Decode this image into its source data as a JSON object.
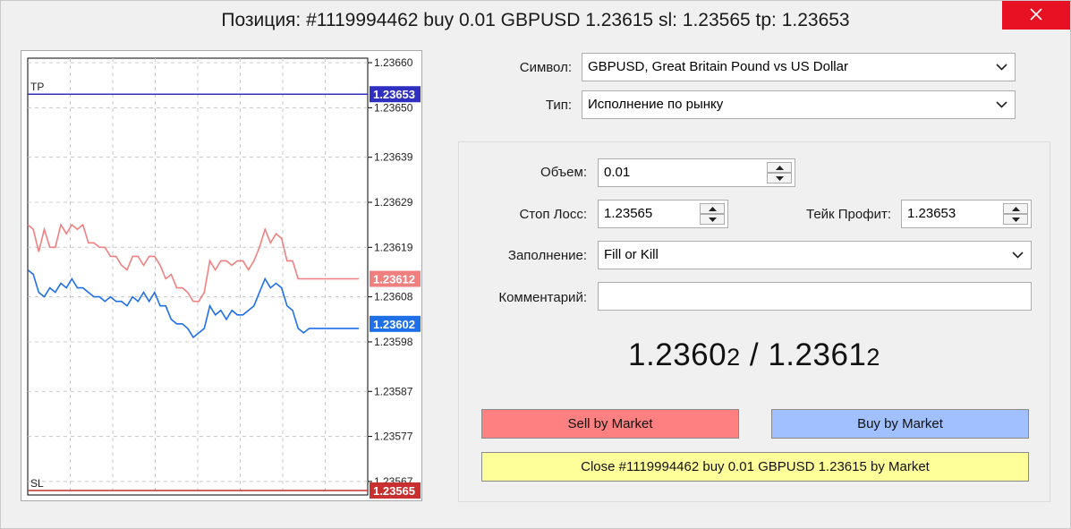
{
  "window": {
    "title": "Позиция: #1119994462 buy 0.01 GBPUSD 1.23615 sl: 1.23565 tp: 1.23653"
  },
  "form": {
    "symbol_label": "Символ:",
    "symbol_value": "GBPUSD, Great Britain Pound vs US Dollar",
    "type_label": "Тип:",
    "type_value": "Исполнение по рынку",
    "volume_label": "Объем:",
    "volume_value": "0.01",
    "sl_label": "Стоп Лосс:",
    "sl_value": "1.23565",
    "tp_label": "Тейк Профит:",
    "tp_value": "1.23653",
    "fill_label": "Заполнение:",
    "fill_value": "Fill or Kill",
    "comment_label": "Комментарий:",
    "comment_value": ""
  },
  "quote": {
    "bid_main": "1.2360",
    "bid_small": "2",
    "separator": "/",
    "ask_main": "1.2361",
    "ask_small": "2"
  },
  "buttons": {
    "sell": "Sell by Market",
    "buy": "Buy by Market",
    "close": "Close #1119994462 buy 0.01 GBPUSD 1.23615 by Market"
  },
  "colors": {
    "sell_button": "#ff8080",
    "buy_button": "#a0c0ff",
    "close_button": "#ffff99",
    "bid_line": "#1e6fe8",
    "ask_line": "#f08080",
    "tp_line": "#3030c0",
    "sl_line": "#c83030"
  },
  "chart_data": {
    "type": "line",
    "y_ticks": [
      "1.23660",
      "1.23650",
      "1.23639",
      "1.23629",
      "1.23619",
      "1.23608",
      "1.23598",
      "1.23587",
      "1.23577",
      "1.23567"
    ],
    "ylim": [
      1.23564,
      1.23661
    ],
    "levels": [
      {
        "label": "TP",
        "value": 1.23653,
        "price_label": "1.23653"
      },
      {
        "label": "SL",
        "value": 1.23565,
        "price_label": "1.23565"
      }
    ],
    "current": {
      "ask": {
        "value": 1.23612,
        "price_label": "1.23612"
      },
      "bid": {
        "value": 1.23602,
        "price_label": "1.23602"
      }
    },
    "series": [
      {
        "values": [
          1.23624,
          1.23623,
          1.23618,
          1.23623,
          1.23619,
          1.23619,
          1.23624,
          1.23622,
          1.23624,
          1.23623,
          1.23624,
          1.2362,
          1.2362,
          1.23619,
          1.23619,
          1.23617,
          1.23617,
          1.23615,
          1.23614,
          1.23617,
          1.23617,
          1.23615,
          1.23617,
          1.23617,
          1.23615,
          1.23612,
          1.23613,
          1.2361,
          1.2361,
          1.23609,
          1.23607,
          1.23607,
          1.23609,
          1.23616,
          1.23614,
          1.23616,
          1.23616,
          1.23615,
          1.23616,
          1.23616,
          1.23614,
          1.23616,
          1.23619,
          1.23623,
          1.2362,
          1.23622,
          1.23621,
          1.23616,
          1.23616,
          1.23612,
          1.23612,
          1.23612,
          1.23612,
          1.23612,
          1.23612,
          1.23612,
          1.23612,
          1.23612,
          1.23612,
          1.23612,
          1.23612
        ]
      },
      {
        "values": [
          1.23614,
          1.23613,
          1.23609,
          1.23608,
          1.2361,
          1.23609,
          1.23611,
          1.2361,
          1.23612,
          1.2361,
          1.2361,
          1.23609,
          1.23608,
          1.23608,
          1.23607,
          1.23608,
          1.23607,
          1.23607,
          1.23606,
          1.23608,
          1.23607,
          1.23609,
          1.23607,
          1.23609,
          1.23606,
          1.23606,
          1.23603,
          1.23602,
          1.23602,
          1.23601,
          1.23599,
          1.236,
          1.23601,
          1.23606,
          1.23604,
          1.23605,
          1.23603,
          1.23605,
          1.23604,
          1.23604,
          1.23605,
          1.23606,
          1.23609,
          1.23612,
          1.2361,
          1.23611,
          1.2361,
          1.23606,
          1.23605,
          1.23601,
          1.236,
          1.23601,
          1.23601,
          1.23601,
          1.23601,
          1.23601,
          1.23601,
          1.23601,
          1.23601,
          1.23601,
          1.23601
        ]
      }
    ],
    "grid": true
  }
}
